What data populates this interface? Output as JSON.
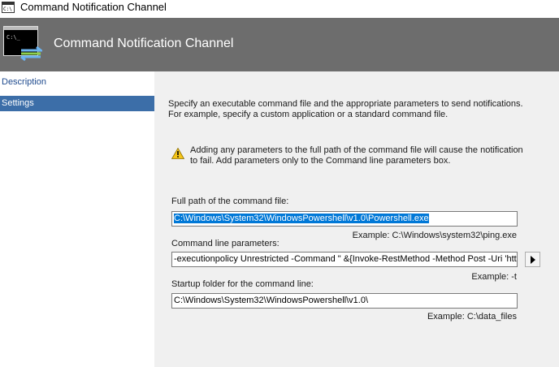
{
  "window": {
    "title": "Command Notification Channel"
  },
  "header": {
    "title": "Command Notification Channel"
  },
  "sidebar": {
    "items": [
      {
        "label": "Description",
        "active": false
      },
      {
        "label": "Settings",
        "active": true
      }
    ]
  },
  "settings": {
    "intro_line1": "Specify an executable command file and the appropriate parameters to send notifications.",
    "intro_line2": "For example, specify a custom application or a standard command file.",
    "warning_line1": "Adding any parameters to the full path of the command file will cause the notification",
    "warning_line2": "to fail. Add parameters only to the Command line parameters box.",
    "full_path": {
      "label": "Full path of the command file:",
      "value": "C:\\Windows\\System32\\WindowsPowershell\\v1.0\\Powershell.exe",
      "example": "Example: C:\\Windows\\system32\\ping.exe"
    },
    "command_line": {
      "label": "Command line parameters:",
      "value": "-executionpolicy Unrestricted -Command \" &{Invoke-RestMethod -Method Post -Uri 'https://",
      "example": "Example: -t"
    },
    "startup_folder": {
      "label": "Startup folder for the command line:",
      "value": "C:\\Windows\\System32\\WindowsPowershell\\v1.0\\",
      "example": "Example: C:\\data_files"
    }
  },
  "colors": {
    "header_bg": "#6d6d6d",
    "selected_nav": "#3c6ea8",
    "selection": "#0078d7",
    "content_bg": "#f0f0f0"
  },
  "icons": {
    "app": "terminal-icon",
    "header": "command-channel-icon",
    "warning": "warning-icon",
    "insert": "triangle-right-icon"
  }
}
